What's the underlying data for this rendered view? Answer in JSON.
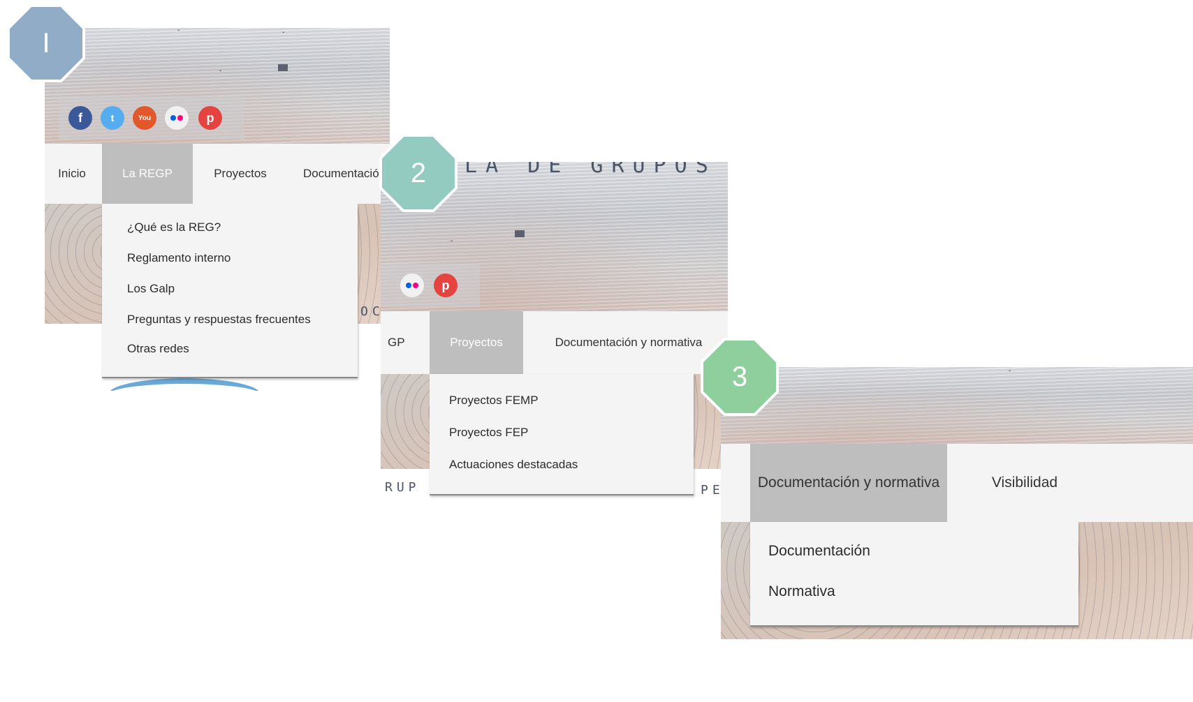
{
  "steps": [
    {
      "number": "I",
      "color": "#91acc7",
      "social_icons": [
        "facebook-icon",
        "twitter-icon",
        "youtube-icon",
        "flickr-icon",
        "pinterest-icon"
      ],
      "nav": [
        "Inicio",
        "La REGP",
        "Proyectos",
        "Documentació"
      ],
      "active": "La REGP",
      "submenu": [
        "¿Qué es la REG?",
        "Reglamento interno",
        "Los Galp",
        "Preguntas y respuestas frecuentes",
        "Otras redes"
      ],
      "side_text": "OCA"
    },
    {
      "number": "2",
      "color": "#93cbc0",
      "banner_title": "OLA DE GRUPOS",
      "social_icons": [
        "flickr-icon",
        "pinterest-icon"
      ],
      "nav": [
        "GP",
        "Proyectos",
        "Documentación y normativa"
      ],
      "active": "Proyectos",
      "submenu": [
        "Proyectos FEMP",
        "Proyectos FEP",
        "Actuaciones destacadas"
      ],
      "footer_left": "RUP",
      "footer_right": "PE"
    },
    {
      "number": "3",
      "color": "#8fcf9d",
      "nav": [
        "Documentación y normativa",
        "Visibilidad"
      ],
      "active": "Documentación y normativa",
      "submenu": [
        "Documentación",
        "Normativa"
      ]
    }
  ],
  "colors": {
    "facebook": "#3b5998",
    "twitter": "#55acee",
    "youtube": "#e2582c",
    "flickr_pink": "#ff0084",
    "flickr_blue": "#0063dc",
    "pinterest": "#e5433f"
  }
}
